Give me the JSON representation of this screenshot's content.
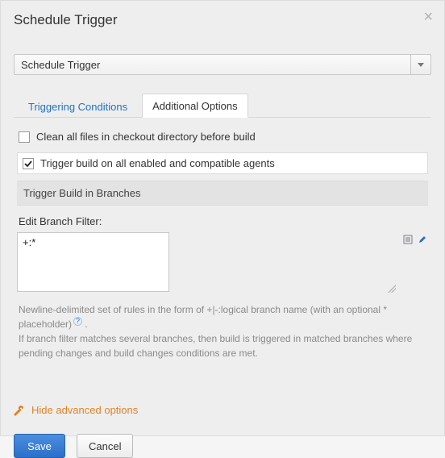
{
  "dialog": {
    "title": "Schedule Trigger"
  },
  "select": {
    "value": "Schedule Trigger"
  },
  "tabs": {
    "triggering": "Triggering Conditions",
    "additional": "Additional Options",
    "active": "additional"
  },
  "options": {
    "clean_label": "Clean all files in checkout directory before build",
    "clean_checked": false,
    "trigger_all_label": "Trigger build on all enabled and compatible agents",
    "trigger_all_checked": true
  },
  "branches": {
    "section_title": "Trigger Build in Branches",
    "filter_label": "Edit Branch Filter:",
    "filter_value": "+:*",
    "help1": "Newline-delimited set of rules in the form of +|-:logical branch name (with an optional * placeholder)",
    "help1_suffix": ".",
    "help2": "If branch filter matches several branches, then build is triggered in matched branches where pending changes and build changes conditions are met."
  },
  "advanced": {
    "label": "Hide advanced options"
  },
  "footer": {
    "save": "Save",
    "cancel": "Cancel"
  }
}
